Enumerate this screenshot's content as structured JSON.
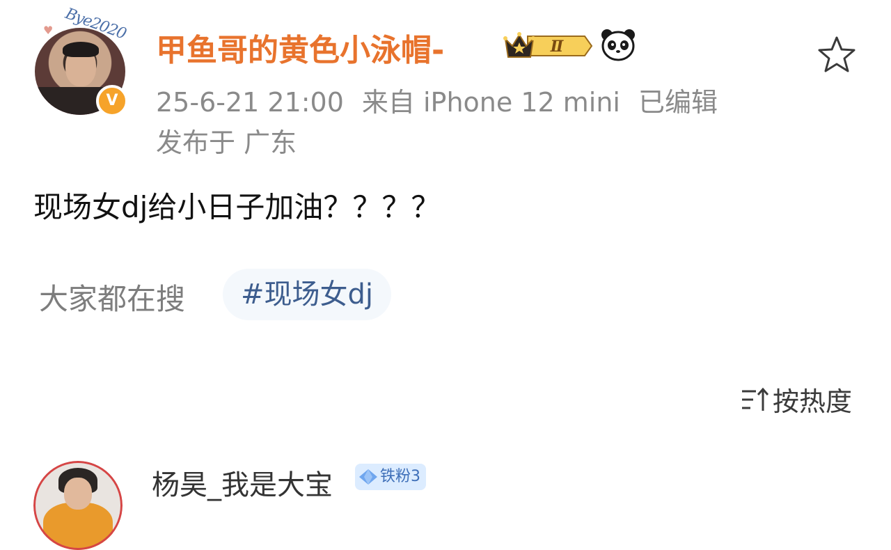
{
  "post": {
    "author": {
      "name": "甲鱼哥的黄色小泳帽-",
      "avatar_overlay_text": "Bye2020",
      "verified_badge": "V",
      "level_badge": "Ⅱ"
    },
    "meta": {
      "timestamp": "25-6-21 21:00",
      "source": "来自 iPhone 12 mini",
      "edited": "已编辑",
      "location": "发布于 广东"
    },
    "content": "现场女dj给小日子加油？？？？",
    "search": {
      "label": "大家都在搜",
      "tag": "#现场女dj"
    },
    "sort": {
      "label": "按热度"
    }
  },
  "comments": [
    {
      "name": "杨昊_我是大宝",
      "badge": "铁粉3"
    }
  ],
  "colors": {
    "username": "#e8732d",
    "meta_text": "#8a8a8a",
    "tag_text": "#3d5d8e",
    "tag_bg": "#f4f8fc",
    "verified_bg": "#f6a32a",
    "fan_badge_bg": "#dcecff"
  }
}
